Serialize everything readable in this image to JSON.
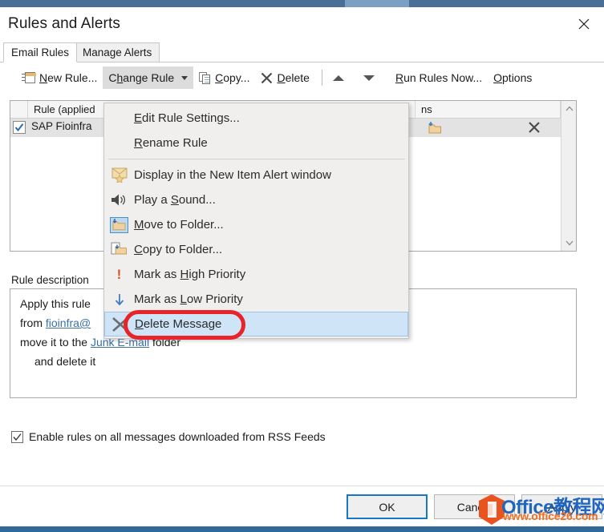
{
  "window": {
    "title": "Rules and Alerts",
    "close_icon": "close-icon"
  },
  "tabs": [
    {
      "label": "Email Rules",
      "active": true
    },
    {
      "label": "Manage Alerts",
      "active": false
    }
  ],
  "toolbar": {
    "new_rule": "New Rule...",
    "change_rule": "Change Rule",
    "copy": "Copy...",
    "delete": "Delete",
    "move_up_icon": "arrow-up-icon",
    "move_down_icon": "arrow-down-icon",
    "run_rules_now": "Run Rules Now...",
    "options": "Options"
  },
  "rules_list": {
    "columns": [
      "",
      "Rule (applied",
      "ns"
    ],
    "rows": [
      {
        "checked": true,
        "name": "SAP Fioinfra",
        "actions": [
          "move-to-folder-icon",
          "delete-icon"
        ]
      }
    ],
    "scroll_up_icon": "chevron-up-icon",
    "scroll_down_icon": "chevron-down-icon"
  },
  "description": {
    "label": "Rule description",
    "lines": [
      "Apply this rule",
      "from fioinfra@",
      "move it to the Junk E-mail folder",
      "and delete it"
    ],
    "link_1": "fioinfra@",
    "link_2": "Junk E-mail"
  },
  "rss": {
    "label": "Enable rules on all messages downloaded from RSS Feeds",
    "checked": true
  },
  "buttons": {
    "ok": "OK",
    "cancel": "Cancel",
    "apply": "Apply"
  },
  "dropdown": {
    "items": [
      {
        "label": "Edit Rule Settings...",
        "icon": null,
        "selected": false
      },
      {
        "label": "Rename Rule",
        "icon": null,
        "selected": false
      },
      {
        "label": "Display in the New Item Alert window",
        "icon": "new-item-alert-icon",
        "selected": false
      },
      {
        "label": "Play a Sound...",
        "icon": "speaker-icon",
        "selected": false
      },
      {
        "label": "Move to Folder...",
        "icon": "move-to-folder-icon",
        "selected": false
      },
      {
        "label": "Copy to Folder...",
        "icon": "copy-to-folder-icon",
        "selected": false
      },
      {
        "label": "Mark as High Priority",
        "icon": "high-priority-icon",
        "selected": false
      },
      {
        "label": "Mark as Low Priority",
        "icon": "low-priority-icon",
        "selected": false
      },
      {
        "label": "Delete Message",
        "icon": "delete-message-icon",
        "selected": true
      }
    ]
  },
  "annotation": {
    "shape": "ellipse",
    "color": "#e8232a",
    "target": "Delete Message"
  },
  "watermark": {
    "title": "Office教程网",
    "url": "www.office26.com",
    "logo_icon": "office-logo-icon",
    "title_color": "#1f66c0",
    "url_color": "#f07021"
  }
}
